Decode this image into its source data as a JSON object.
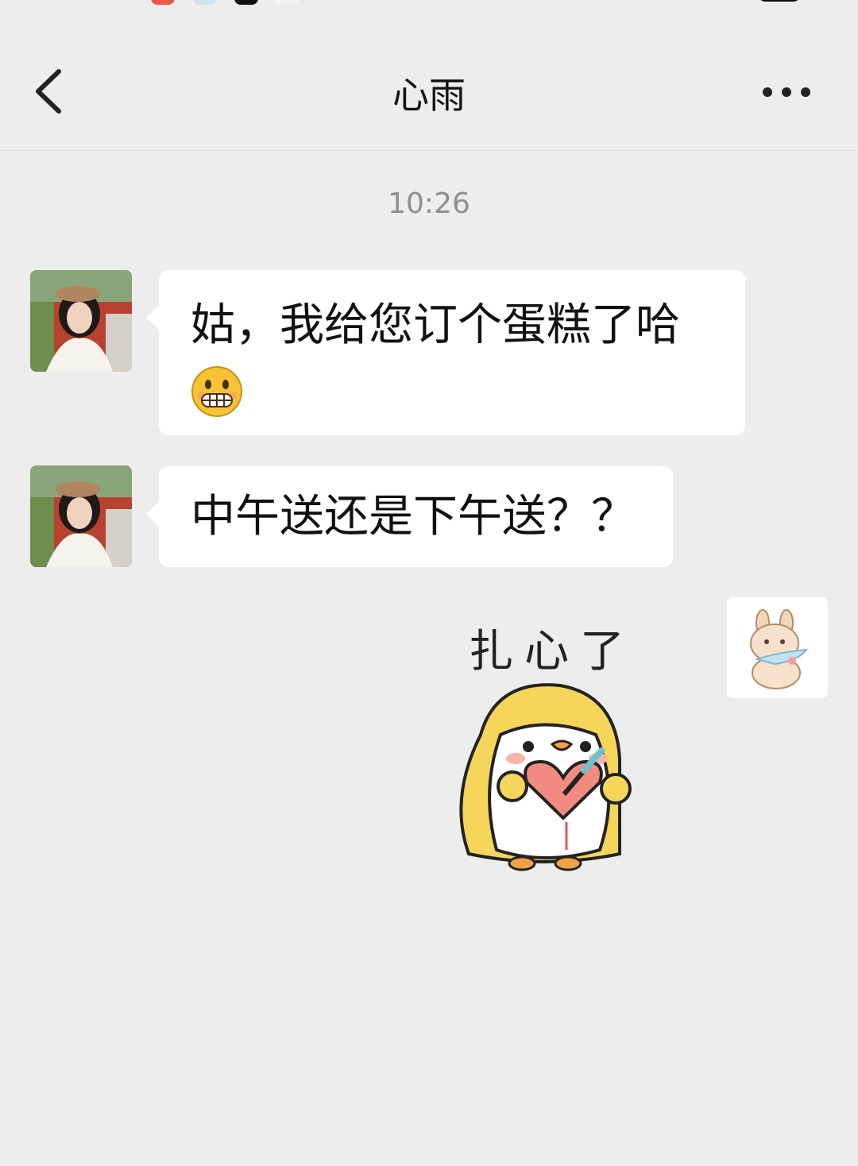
{
  "header": {
    "title": "心雨"
  },
  "timestamp": "10:26",
  "messages": [
    {
      "sender": "contact",
      "text": "姑，我给您订个蛋糕了哈",
      "emoji": "grimacing-face"
    },
    {
      "sender": "contact",
      "text": "中午送还是下午送？？"
    },
    {
      "sender": "me",
      "type": "sticker",
      "sticker_text": "扎心了"
    }
  ],
  "icons": {
    "back": "chevron-left-icon",
    "more": "ellipsis-icon"
  },
  "colors": {
    "background": "#ededed",
    "bubble": "#ffffff",
    "timestamp": "#8f8f8f"
  }
}
